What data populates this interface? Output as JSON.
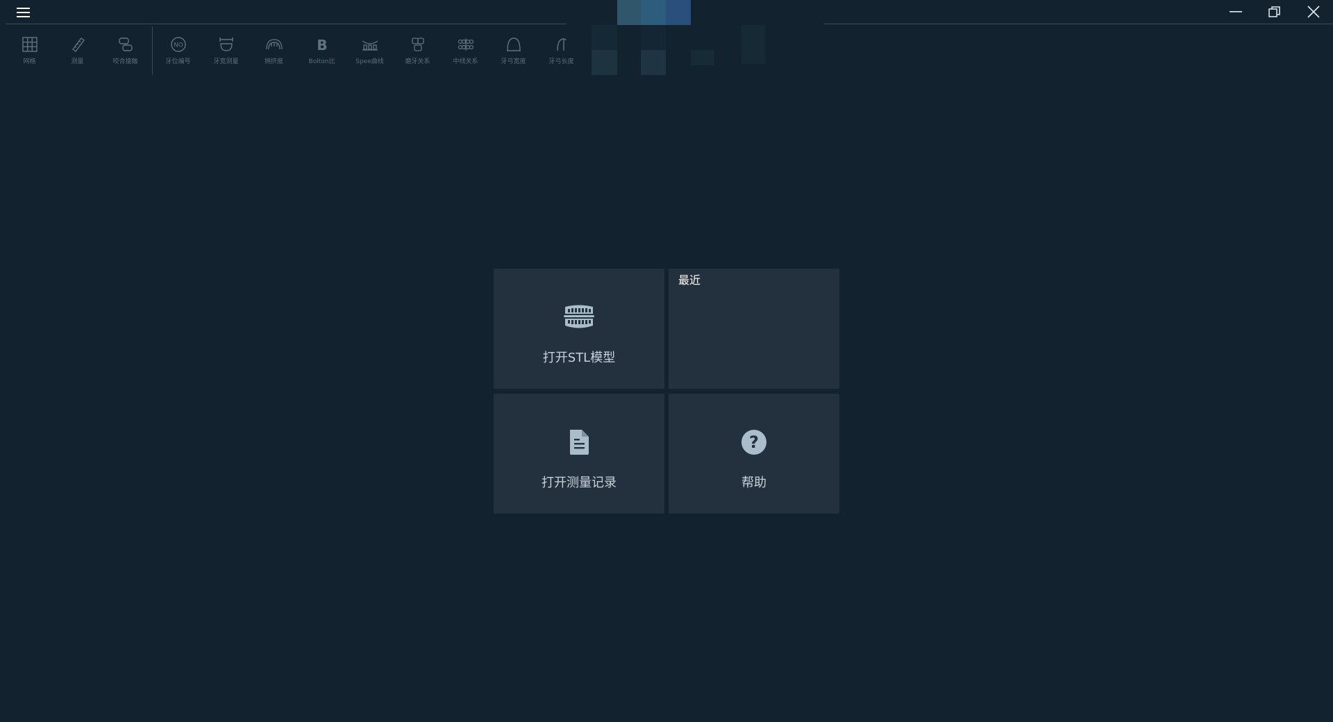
{
  "window": {
    "controls": {
      "minimize_icon": "minimize-icon",
      "restore_icon": "restore-icon",
      "close_icon": "close-icon"
    }
  },
  "toolbar": {
    "groups": [
      [
        {
          "id": "grid",
          "label": "网格",
          "icon": "grid-icon"
        },
        {
          "id": "measure",
          "label": "测量",
          "icon": "ruler-icon"
        },
        {
          "id": "occlusion",
          "label": "咬合接触",
          "icon": "occlusion-icon"
        }
      ],
      [
        {
          "id": "tooth-number",
          "label": "牙位编号",
          "icon": "tooth-number-icon"
        },
        {
          "id": "tooth-width",
          "label": "牙宽测量",
          "icon": "tooth-width-icon"
        },
        {
          "id": "crowding",
          "label": "拥挤度",
          "icon": "crowding-icon"
        },
        {
          "id": "bolton",
          "label": "Bolton比",
          "icon": "bolton-icon"
        },
        {
          "id": "spee",
          "label": "Spee曲线",
          "icon": "spee-curve-icon"
        },
        {
          "id": "molar",
          "label": "磨牙关系",
          "icon": "molar-relation-icon"
        },
        {
          "id": "midline",
          "label": "中线关系",
          "icon": "midline-relation-icon"
        },
        {
          "id": "arch-width",
          "label": "牙弓宽度",
          "icon": "arch-width-icon"
        },
        {
          "id": "arch-length",
          "label": "牙弓长度",
          "icon": "arch-length-icon"
        }
      ]
    ]
  },
  "tiles": {
    "open_stl": {
      "label": "打开STL模型",
      "icon": "teeth-model-icon"
    },
    "recent": {
      "title": "最近"
    },
    "open_record": {
      "label": "打开测量记录",
      "icon": "document-icon"
    },
    "help": {
      "label": "帮助",
      "icon": "help-icon"
    }
  },
  "colors": {
    "background": "#12232f",
    "tile": "#23313f",
    "icon": "#aabdcb"
  }
}
